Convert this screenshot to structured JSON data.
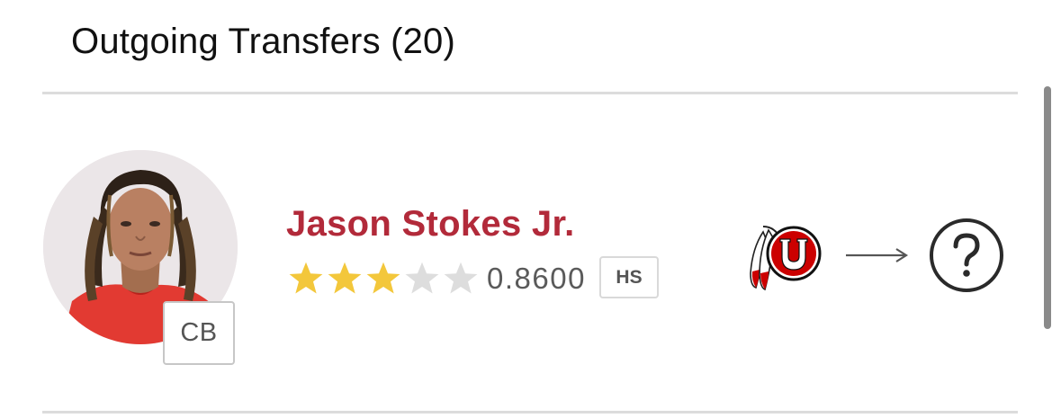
{
  "section": {
    "title": "Outgoing Transfers (20)"
  },
  "player": {
    "name": "Jason Stokes Jr.",
    "position": "CB",
    "rating": "0.8600",
    "level": "HS",
    "stars_filled": 3,
    "stars_total": 5,
    "from_school_icon": "utah-utes-logo",
    "to_school_icon": "unknown-destination-icon"
  },
  "colors": {
    "name": "#b22a3a",
    "star_filled": "#f3c73b",
    "star_empty": "#dddddd",
    "divider": "#dcdcdc",
    "utah_red": "#cc0000"
  }
}
